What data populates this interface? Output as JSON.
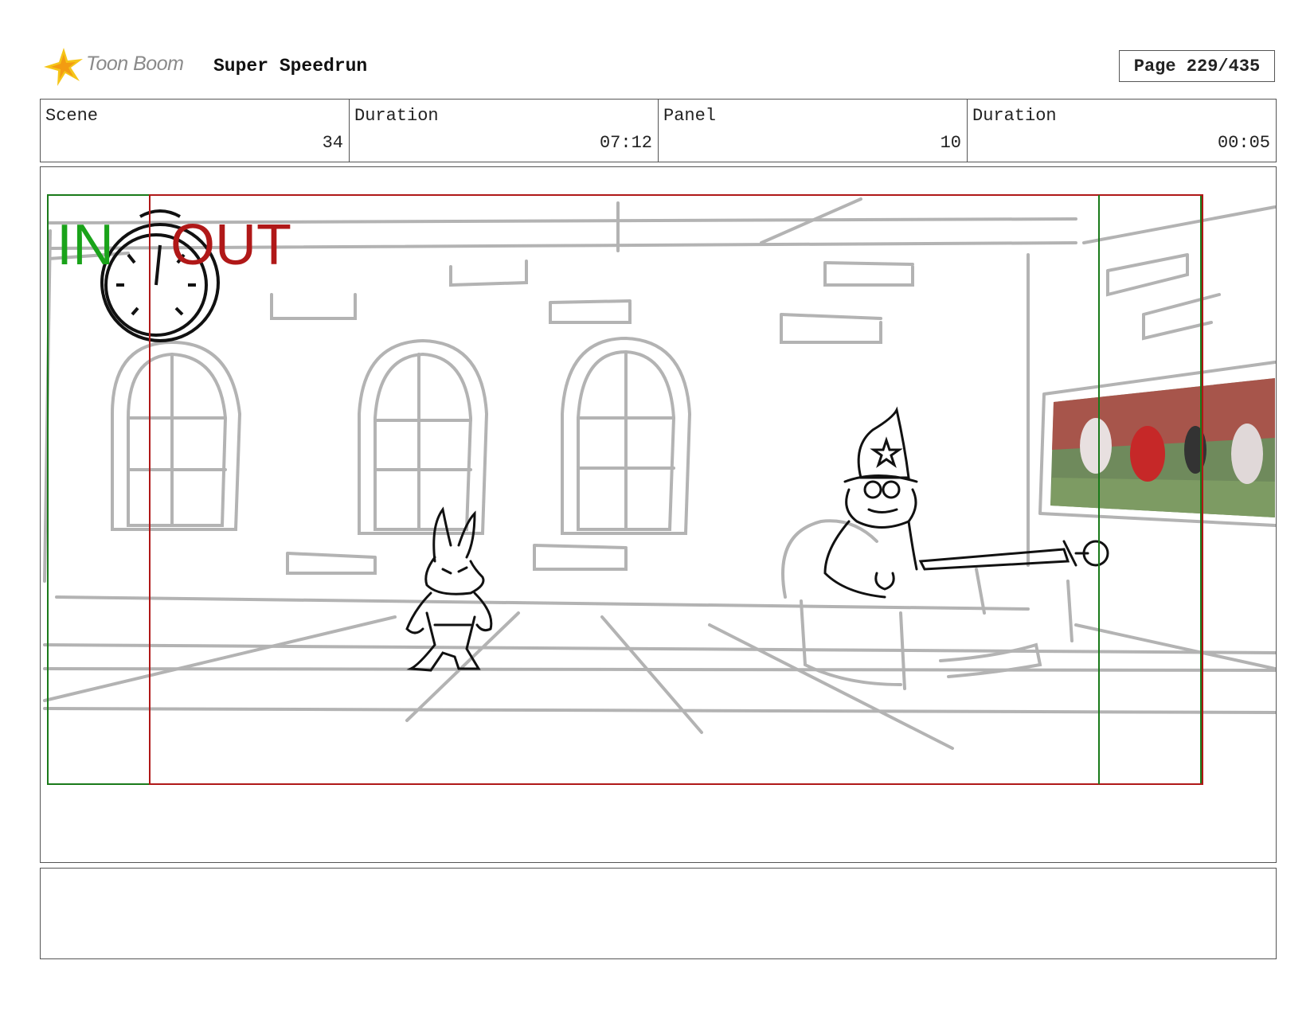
{
  "header": {
    "logo_text": "Toon Boom",
    "project_title": "Super Speedrun",
    "page_label": "Page 229/435"
  },
  "info": {
    "scene_label": "Scene",
    "scene_value": "34",
    "scene_duration_label": "Duration",
    "scene_duration_value": "07:12",
    "panel_label": "Panel",
    "panel_value": "10",
    "panel_duration_label": "Duration",
    "panel_duration_value": "00:05"
  },
  "panel": {
    "in_marker": "IN",
    "out_marker": "OUT",
    "in_color": "#1aa31a",
    "out_color": "#b01818",
    "sketch_color": "#b3b3b3",
    "ink_color": "#111111"
  },
  "notes": {
    "text": ""
  },
  "icons": {
    "logo": "toon-boom-star-icon",
    "stopwatch": "stopwatch-icon",
    "wizard_star": "star-icon"
  },
  "colors": {
    "logo_yellow": "#f5c518",
    "logo_orange": "#f39c12",
    "border": "#555555"
  }
}
